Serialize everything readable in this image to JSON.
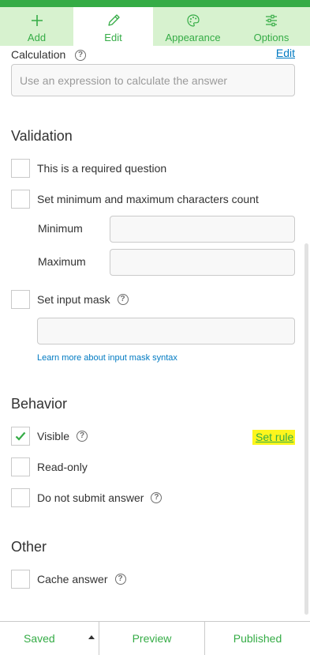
{
  "tabs": [
    {
      "label": "Add",
      "icon": "plus-icon"
    },
    {
      "label": "Edit",
      "icon": "pencil-icon"
    },
    {
      "label": "Appearance",
      "icon": "palette-icon"
    },
    {
      "label": "Options",
      "icon": "sliders-icon"
    }
  ],
  "active_tab": "Edit",
  "calculation": {
    "label": "Calculation",
    "edit_link": "Edit",
    "placeholder": "Use an expression to calculate the answer"
  },
  "validation": {
    "title": "Validation",
    "required_label": "This is a required question",
    "minmax_label": "Set minimum and maximum characters count",
    "minimum_label": "Minimum",
    "maximum_label": "Maximum",
    "input_mask_label": "Set input mask",
    "learn_more": "Learn more about input mask syntax"
  },
  "behavior": {
    "title": "Behavior",
    "visible_label": "Visible",
    "visible_checked": true,
    "set_rule": "Set rule",
    "readonly_label": "Read-only",
    "do_not_submit_label": "Do not submit answer"
  },
  "other": {
    "title": "Other",
    "cache_label": "Cache answer"
  },
  "footer": {
    "saved": "Saved",
    "preview": "Preview",
    "published": "Published"
  },
  "colors": {
    "accent": "#35ac46",
    "tab_bar": "#d7f2cf",
    "link": "#007ac2",
    "highlight": "#fdf51d"
  }
}
